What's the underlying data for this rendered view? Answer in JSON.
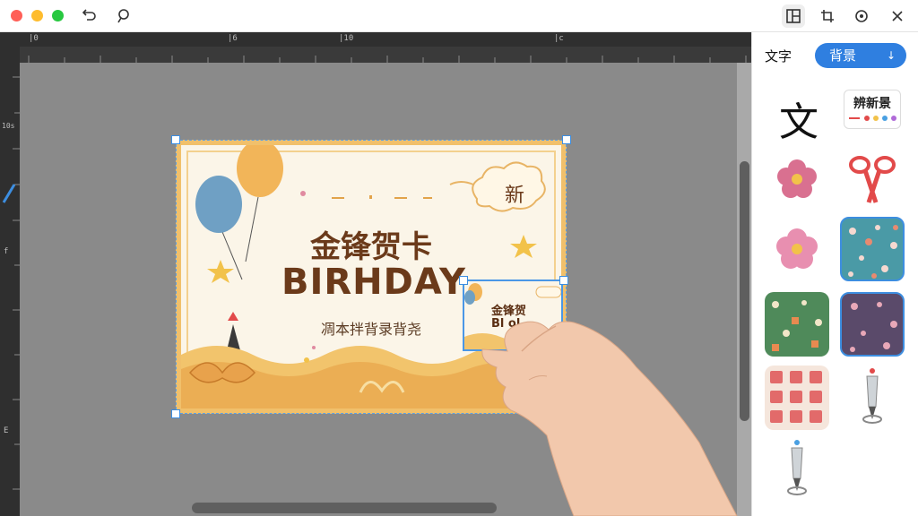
{
  "titlebar": {
    "traffic": {
      "close": "#ff5f57",
      "minimize": "#febc2e",
      "zoom": "#28c840"
    },
    "left_icons": [
      "undo-icon",
      "lasso-icon"
    ],
    "right_icons": [
      "layout-icon",
      "crop-icon",
      "settings-icon",
      "close-icon"
    ]
  },
  "rulers": {
    "top": [
      "|0",
      "|6",
      "|10",
      "|c"
    ],
    "left": [
      "10s",
      "f",
      "E"
    ]
  },
  "card": {
    "title_cn": "金锋贺卡",
    "title_en": "BIRHDAY",
    "subtitle": "凋本拌背录背尧",
    "cloud_char": "新",
    "colors": {
      "border": "#f1c06b",
      "text": "#6b3a1a",
      "background": "#fbf5e8"
    }
  },
  "mini_card": {
    "line1": "金锋贺",
    "line2": "Bl    ol"
  },
  "panel": {
    "tab_text": "文字",
    "tab_background": "背景",
    "big_char": "文",
    "label_asset": "辨新景",
    "assets": [
      "flower-sticker-icon",
      "scissors-icon",
      "pink-flower-icon",
      "teal-pattern",
      "green-pattern",
      "purple-pattern",
      "red-pattern",
      "pen-icon",
      "pen-icon-2"
    ]
  },
  "accent": "#2f7fe0"
}
